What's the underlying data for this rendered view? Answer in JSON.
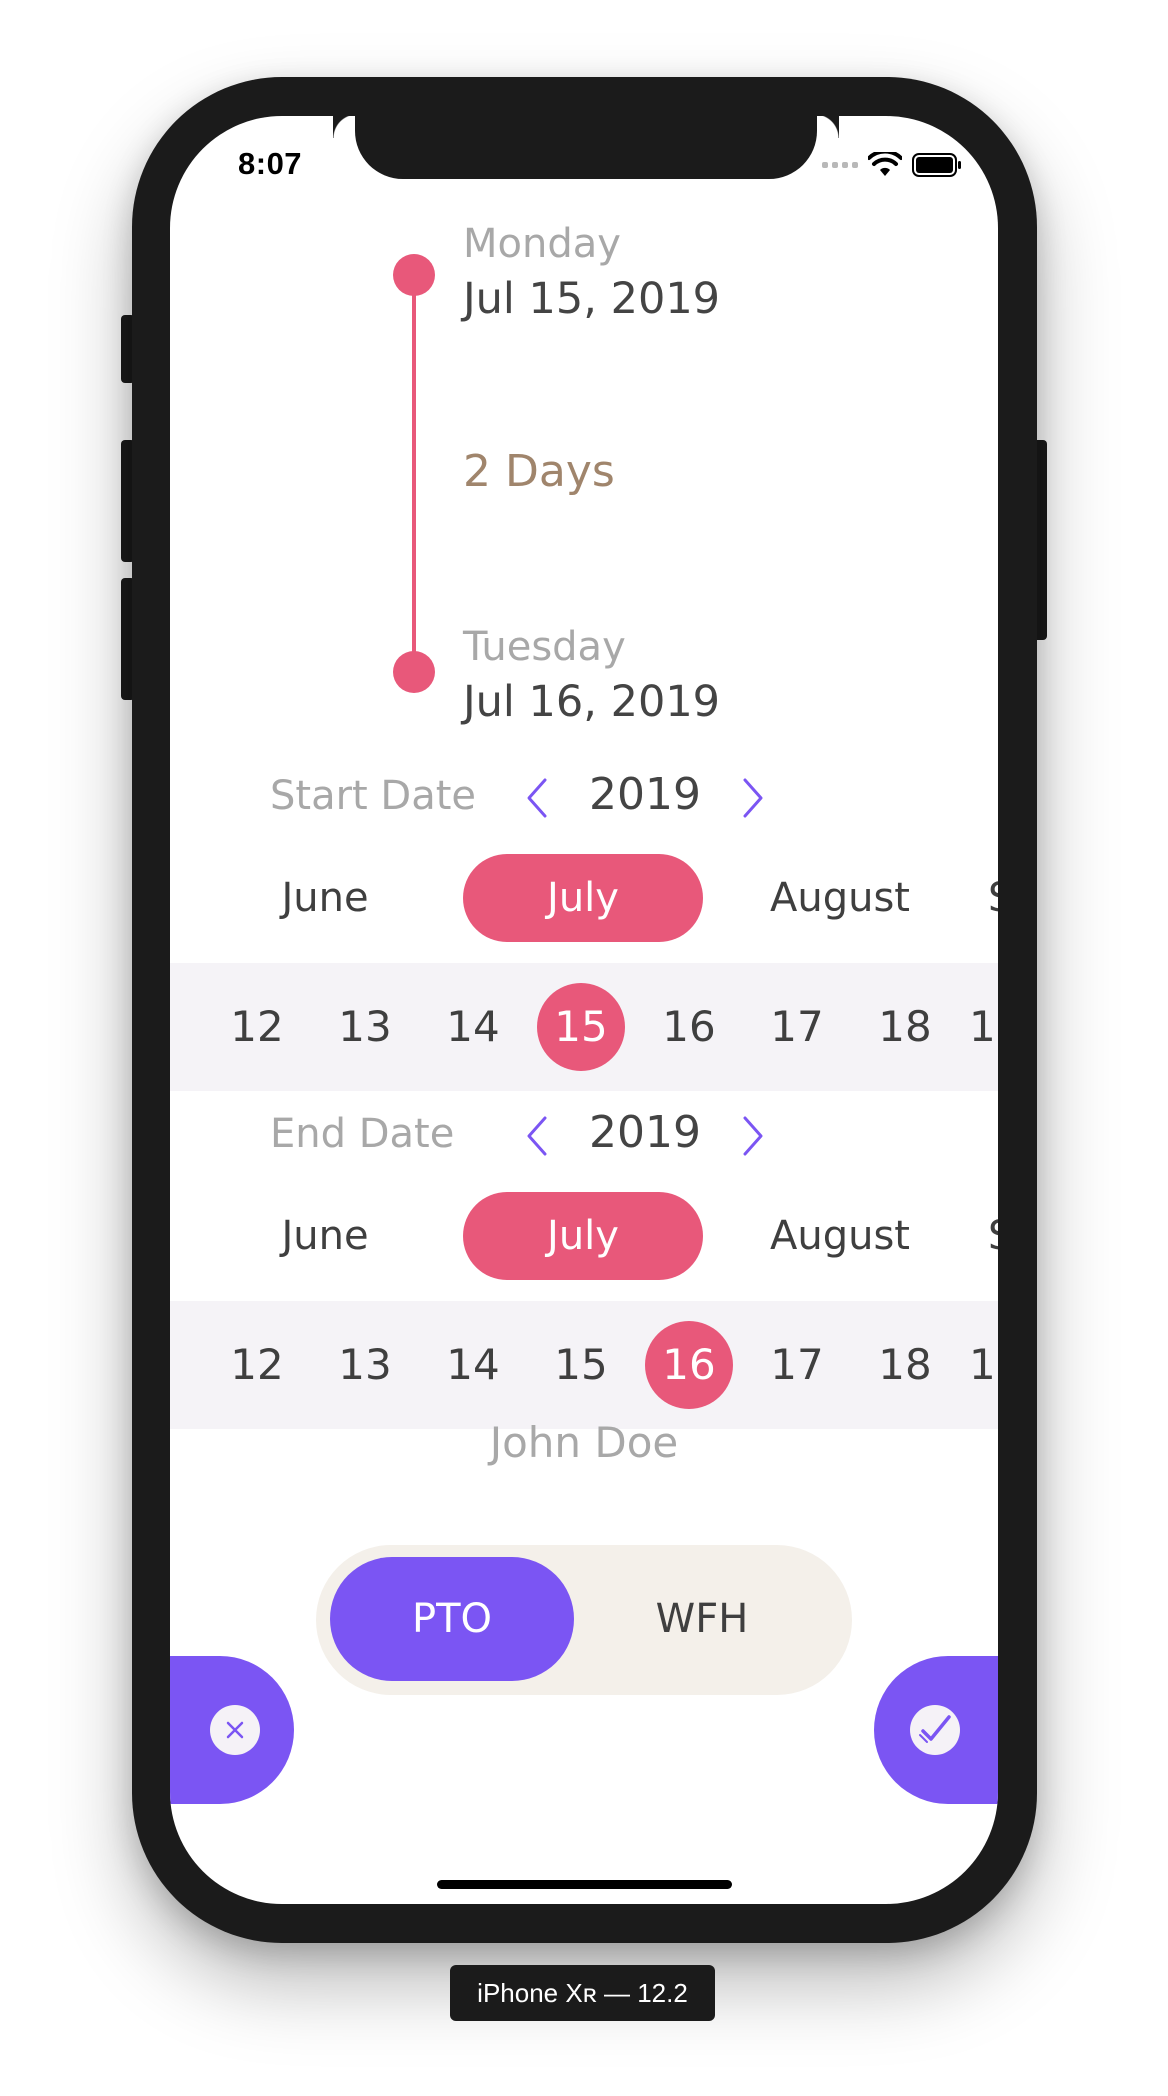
{
  "status_bar": {
    "time": "8:07"
  },
  "timeline": {
    "start": {
      "weekday": "Monday",
      "date": "Jul 15, 2019"
    },
    "duration": "2 Days",
    "end": {
      "weekday": "Tuesday",
      "date": "Jul 16, 2019"
    }
  },
  "start_picker": {
    "label": "Start Date",
    "year": "2019",
    "months": [
      "June",
      "July",
      "August",
      "S"
    ],
    "selected_month": "July",
    "days": [
      "12",
      "13",
      "14",
      "15",
      "16",
      "17",
      "18",
      "1"
    ],
    "selected_day": "15"
  },
  "end_picker": {
    "label": "End Date",
    "year": "2019",
    "months": [
      "June",
      "July",
      "August",
      "S"
    ],
    "selected_month": "July",
    "days": [
      "12",
      "13",
      "14",
      "15",
      "16",
      "17",
      "18",
      "1"
    ],
    "selected_day": "16"
  },
  "user": {
    "name": "John Doe"
  },
  "type_toggle": {
    "options": [
      "PTO",
      "WFH"
    ],
    "selected": "PTO"
  },
  "actions": {
    "cancel_icon": "close-icon",
    "confirm_icon": "check-icon"
  },
  "device_label": "iPhone Xʀ — 12.2",
  "colors": {
    "accent": "#e8587a",
    "primary": "#7b55f3",
    "duration": "#a0856c"
  }
}
